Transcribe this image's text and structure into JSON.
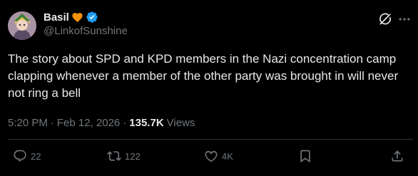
{
  "author": {
    "display_name": "Basil",
    "handle": "@LinkofSunshine",
    "emoji": "orange-heart",
    "verified": true
  },
  "tweet": {
    "text": "The story about SPD and KPD members in the Nazi concentration camp clapping whenever a member of the other party was brought in will never not ring a bell"
  },
  "meta": {
    "time": "5:20 PM",
    "separator": "·",
    "date": "Feb 12, 2026",
    "separator2": "·",
    "views_count": "135.7K",
    "views_label": "Views"
  },
  "actions": {
    "reply_count": "22",
    "repost_count": "122",
    "like_count": "4K"
  },
  "colors": {
    "background": "#000000",
    "text_primary": "#e7e9ea",
    "text_secondary": "#71767b",
    "divider": "#2f3336",
    "verified_blue": "#1d9bf0",
    "heart_orange": "#f4900c"
  },
  "icons": {
    "grok": "grok-icon",
    "more": "more-icon",
    "reply": "reply-icon",
    "repost": "repost-icon",
    "like": "like-icon",
    "bookmark": "bookmark-icon",
    "share": "share-icon"
  }
}
